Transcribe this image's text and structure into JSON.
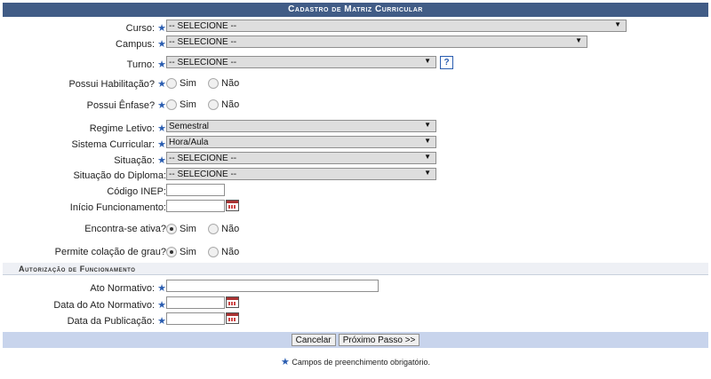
{
  "caption": "Cadastro de Matriz Curricular",
  "fields": {
    "curso": {
      "label": "Curso:",
      "value": "-- SELECIONE --"
    },
    "campus": {
      "label": "Campus:",
      "value": "-- SELECIONE --"
    },
    "turno": {
      "label": "Turno:",
      "value": "-- SELECIONE --",
      "help": "?"
    },
    "habilitacao": {
      "label": "Possui Habilitação?",
      "opt_sim": "Sim",
      "opt_nao": "Não"
    },
    "enfase": {
      "label": "Possui Ênfase?",
      "opt_sim": "Sim",
      "opt_nao": "Não"
    },
    "regime": {
      "label": "Regime Letivo:",
      "value": "Semestral"
    },
    "sistema": {
      "label": "Sistema Curricular:",
      "value": "Hora/Aula"
    },
    "situacao": {
      "label": "Situação:",
      "value": "-- SELECIONE --"
    },
    "situacao_diploma": {
      "label": "Situação do Diploma:",
      "value": "-- SELECIONE --"
    },
    "codigo_inep": {
      "label": "Código INEP:",
      "value": ""
    },
    "inicio": {
      "label": "Início Funcionamento:",
      "value": ""
    },
    "ativa": {
      "label": "Encontra-se ativa?",
      "opt_sim": "Sim",
      "opt_nao": "Não",
      "selected": "Sim"
    },
    "colacao": {
      "label": "Permite colação de grau?",
      "opt_sim": "Sim",
      "opt_nao": "Não",
      "selected": "Sim"
    }
  },
  "autorizacao": {
    "title": "Autorização de Funcionamento",
    "ato": {
      "label": "Ato Normativo:",
      "value": ""
    },
    "data_ato": {
      "label": "Data do Ato Normativo:",
      "value": ""
    },
    "data_pub": {
      "label": "Data da Publicação:",
      "value": ""
    }
  },
  "buttons": {
    "cancel": "Cancelar",
    "next": "Próximo Passo >>"
  },
  "required_star": "★",
  "note": "Campos de preenchimento obrigatório."
}
